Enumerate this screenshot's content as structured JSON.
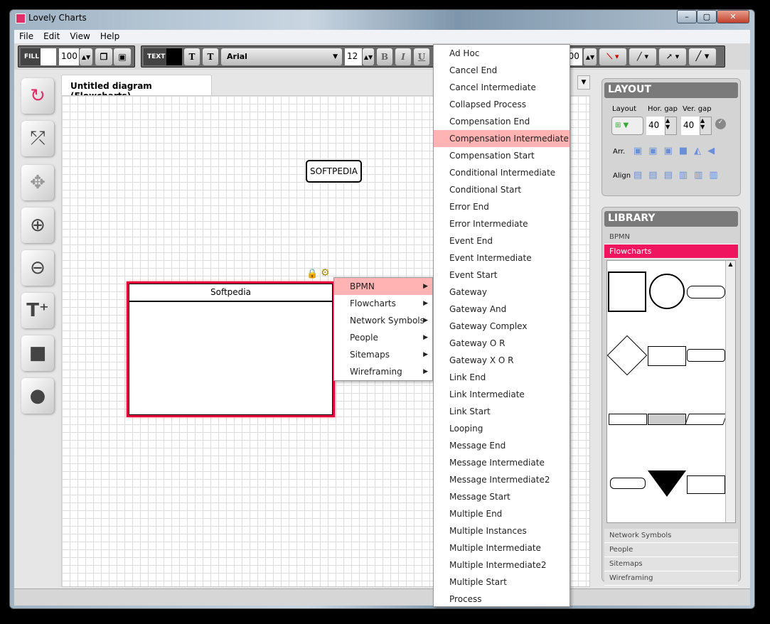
{
  "window": {
    "title": "Lovely Charts",
    "controls": [
      "–",
      "▢",
      "✕"
    ]
  },
  "menubar": [
    "File",
    "Edit",
    "View",
    "Help"
  ],
  "toolbar": {
    "fill_label": "FILL",
    "fill_opacity": "100",
    "text_label": "TEXT",
    "font": "Arial",
    "font_size": "12",
    "bold": "B",
    "italic": "I",
    "underline": "U",
    "line_opacity": "100"
  },
  "tab": {
    "title": "Untitled diagram (Flowcharts)"
  },
  "canvas": {
    "node1": "SOFTPEDIA",
    "node2": "Softpedia"
  },
  "context_menu": [
    {
      "label": "BPMN",
      "highlight": true
    },
    {
      "label": "Flowcharts"
    },
    {
      "label": "Network Symbols"
    },
    {
      "label": "People"
    },
    {
      "label": "Sitemaps"
    },
    {
      "label": "Wireframing"
    }
  ],
  "submenu": [
    "Ad Hoc",
    "Cancel End",
    "Cancel Intermediate",
    "Collapsed Process",
    "Compensation End",
    "Compensation Intermediate",
    "Compensation Start",
    "Conditional Intermediate",
    "Conditional Start",
    "Error End",
    "Error Intermediate",
    "Event End",
    "Event Intermediate",
    "Event Start",
    "Gateway",
    "Gateway And",
    "Gateway Complex",
    "Gateway O R",
    "Gateway X O R",
    "Link End",
    "Link Intermediate",
    "Link Start",
    "Looping",
    "Message End",
    "Message Intermediate",
    "Message Intermediate2",
    "Message Start",
    "Multiple End",
    "Multiple Instances",
    "Multiple Intermediate",
    "Multiple Intermediate2",
    "Multiple Start",
    "Process"
  ],
  "submenu_highlight": "Compensation Intermediate",
  "layout": {
    "title": "LAYOUT",
    "layout_label": "Layout",
    "hgap_label": "Hor. gap",
    "vgap_label": "Ver. gap",
    "hgap": "40",
    "vgap": "40",
    "arr_label": "Arr.",
    "align_label": "Align"
  },
  "library": {
    "title": "LIBRARY",
    "categories_top": [
      "BPMN",
      "Flowcharts"
    ],
    "selected": "Flowcharts",
    "categories_bottom": [
      "Network Symbols",
      "People",
      "Sitemaps",
      "Wireframing"
    ]
  },
  "colors": {
    "accent": "#f0155f",
    "highlight": "#ffb3b3",
    "selection": "#e8003a"
  }
}
